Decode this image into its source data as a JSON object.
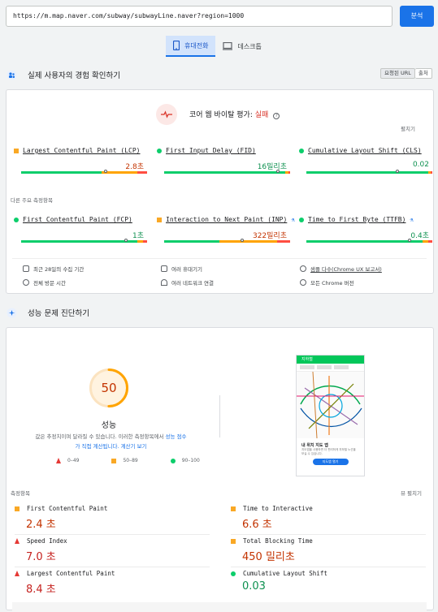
{
  "url": "https://m.map.naver.com/subway/subwayLine.naver?region=1000",
  "analyze_label": "분석",
  "tabs": [
    {
      "label": "휴대전화",
      "active": true
    },
    {
      "label": "데스크톱",
      "active": false
    }
  ],
  "crux": {
    "title": "실제 사용자의 경험 확인하기",
    "url_button": "요청된 URL",
    "origin_button": "출처",
    "assessment_prefix": "코어 웹 바이탈 평가: ",
    "assessment_result": "실패",
    "expand": "펼치기",
    "core": [
      {
        "name": "Largest Contentful Paint (LCP)",
        "value": "2.8초",
        "status": "average",
        "share": [
          0.64,
          0.28,
          0.08
        ],
        "marker": 0.67
      },
      {
        "name": "First Input Delay (FID)",
        "value": "16밀리초",
        "status": "good",
        "share": [
          0.96,
          0.03,
          0.01
        ],
        "marker": 0.9
      },
      {
        "name": "Cumulative Layout Shift (CLS)",
        "value": "0.02",
        "status": "good",
        "share": [
          0.97,
          0.02,
          0.01
        ],
        "marker": 0.72
      }
    ],
    "other_title": "다른 주요 측정항목",
    "other": [
      {
        "name": "First Contentful Paint (FCP)",
        "value": "1초",
        "status": "good",
        "share": [
          0.92,
          0.05,
          0.03
        ],
        "marker": 0.83
      },
      {
        "name": "Interaction to Next Paint (INP)",
        "value": "322밀리초",
        "status": "average",
        "share": [
          0.44,
          0.46,
          0.1
        ],
        "marker": 0.62,
        "experimental": true
      },
      {
        "name": "Time to First Byte (TTFB)",
        "value": "0.4초",
        "status": "good",
        "share": [
          0.92,
          0.05,
          0.03
        ],
        "marker": 0.82,
        "experimental": true
      }
    ],
    "info": [
      "최근 28일의 수집 기간",
      "여러 휴대기기",
      "샘플 다수(Chrome UX 보고서)",
      "전체 방문 시간",
      "여러 네트워크 연결",
      "모든 Chrome 버전"
    ]
  },
  "perf": {
    "title": "성능 문제 진단하기",
    "score": 50,
    "score_label": "성능",
    "desc1": "값은 추정치이며 달라질 수 있습니다. 이러한 측정항목에서 ",
    "desc_link1": "성능 점수",
    "desc_link2": "가 직접 계산됩니다.",
    "desc_link3": "계산기 보기",
    "legend": [
      "0–49",
      "50–89",
      "90–100"
    ],
    "metrics_title": "측정항목",
    "view_toggle": "뷰 펼치기",
    "metrics": [
      {
        "name": "First Contentful Paint",
        "value": "2.4 초",
        "status": "average"
      },
      {
        "name": "Time to Interactive",
        "value": "6.6 초",
        "status": "average"
      },
      {
        "name": "Speed Index",
        "value": "7.0 초",
        "status": "poor"
      },
      {
        "name": "Total Blocking Time",
        "value": "450 밀리초",
        "status": "average"
      },
      {
        "name": "Largest Contentful Paint",
        "value": "8.4 초",
        "status": "poor"
      },
      {
        "name": "Cumulative Layout Shift",
        "value": "0.03",
        "status": "good"
      }
    ],
    "thumb": {
      "title": "지하철",
      "card_title": "내 위치 지도 앱",
      "card_text": "지도앱을 사용하면 더 편리하게 지하철 노선을 보실 수 있습니다.",
      "button": "지도앱 열기"
    }
  },
  "colors": {
    "good": "#0cce6b",
    "average": "#ffa400",
    "poor": "#ff4e42",
    "accent": "#1a73e8"
  }
}
